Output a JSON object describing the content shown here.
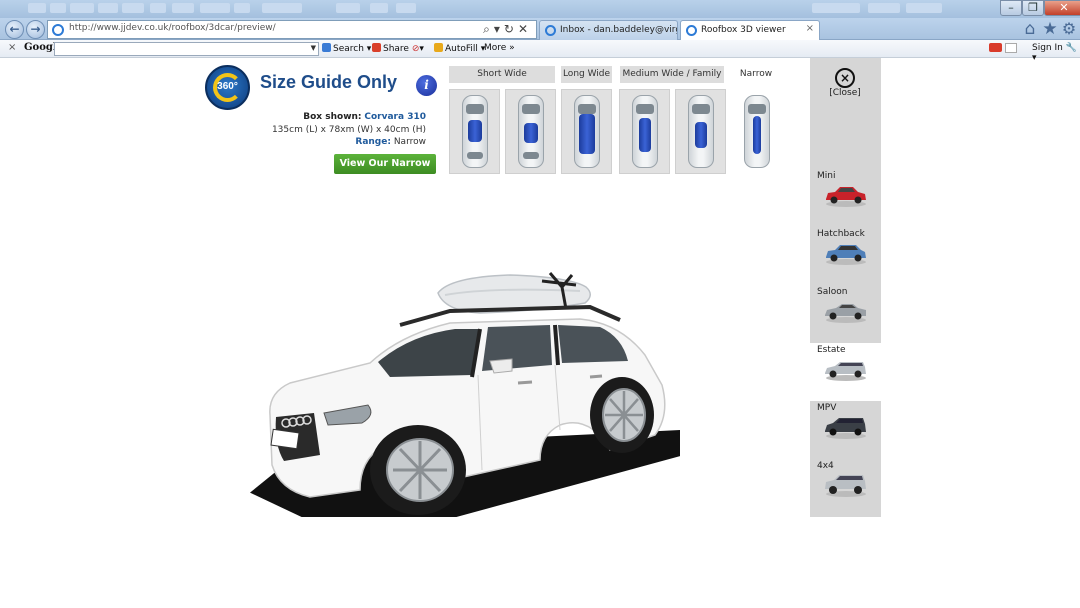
{
  "browser": {
    "url": "http://www.jjdev.co.uk/roofbox/3dcar/preview/",
    "tabs": [
      {
        "label": "Inbox - dan.baddeley@virginm..."
      },
      {
        "label": "Roofbox 3D viewer"
      }
    ],
    "close_tab": "×"
  },
  "google_toolbar": {
    "close": "×",
    "logo": "Google",
    "items": {
      "search": "Search",
      "share": "Share",
      "autofill": "AutoFill",
      "more": "More"
    },
    "sign_in": "Sign In"
  },
  "page": {
    "logo_text": "360°",
    "title": "Size Guide Only",
    "info_icon": "i",
    "box_shown_label": "Box shown:",
    "box_shown_value": "Corvara 310",
    "dimensions": "135cm (L) x 78xm (W) x 40cm (H)",
    "range_label": "Range:",
    "range_value": "Narrow",
    "view_button": "View Our Narrow",
    "ranges": [
      {
        "label": "Short Wide"
      },
      {
        "label": "Long Wide"
      },
      {
        "label": "Medium Wide / Family"
      },
      {
        "label": "Narrow"
      }
    ]
  },
  "sidebar": {
    "close_symbol": "×",
    "close_label": "[Close]",
    "vehicles": [
      {
        "label": "Mini",
        "color": "#c8222a"
      },
      {
        "label": "Hatchback",
        "color": "#4f7fb8"
      },
      {
        "label": "Saloon",
        "color": "#9aa0a6"
      },
      {
        "label": "Estate",
        "color": "#b8bec4"
      },
      {
        "label": "MPV",
        "color": "#3a3f46"
      },
      {
        "label": "4x4",
        "color": "#b9bec3"
      }
    ],
    "selected": "Estate"
  },
  "colors": {
    "title_blue": "#1f4d8a",
    "button_green": "#4aa02c",
    "panel_grey": "#d6d6d6",
    "roofbox_blue": "#2a4fc4"
  },
  "icons": {
    "back": "back-arrow-icon",
    "forward": "forward-arrow-icon",
    "home": "home-icon",
    "favorites": "star-icon",
    "tools": "gear-icon",
    "close": "close-circle-icon"
  }
}
